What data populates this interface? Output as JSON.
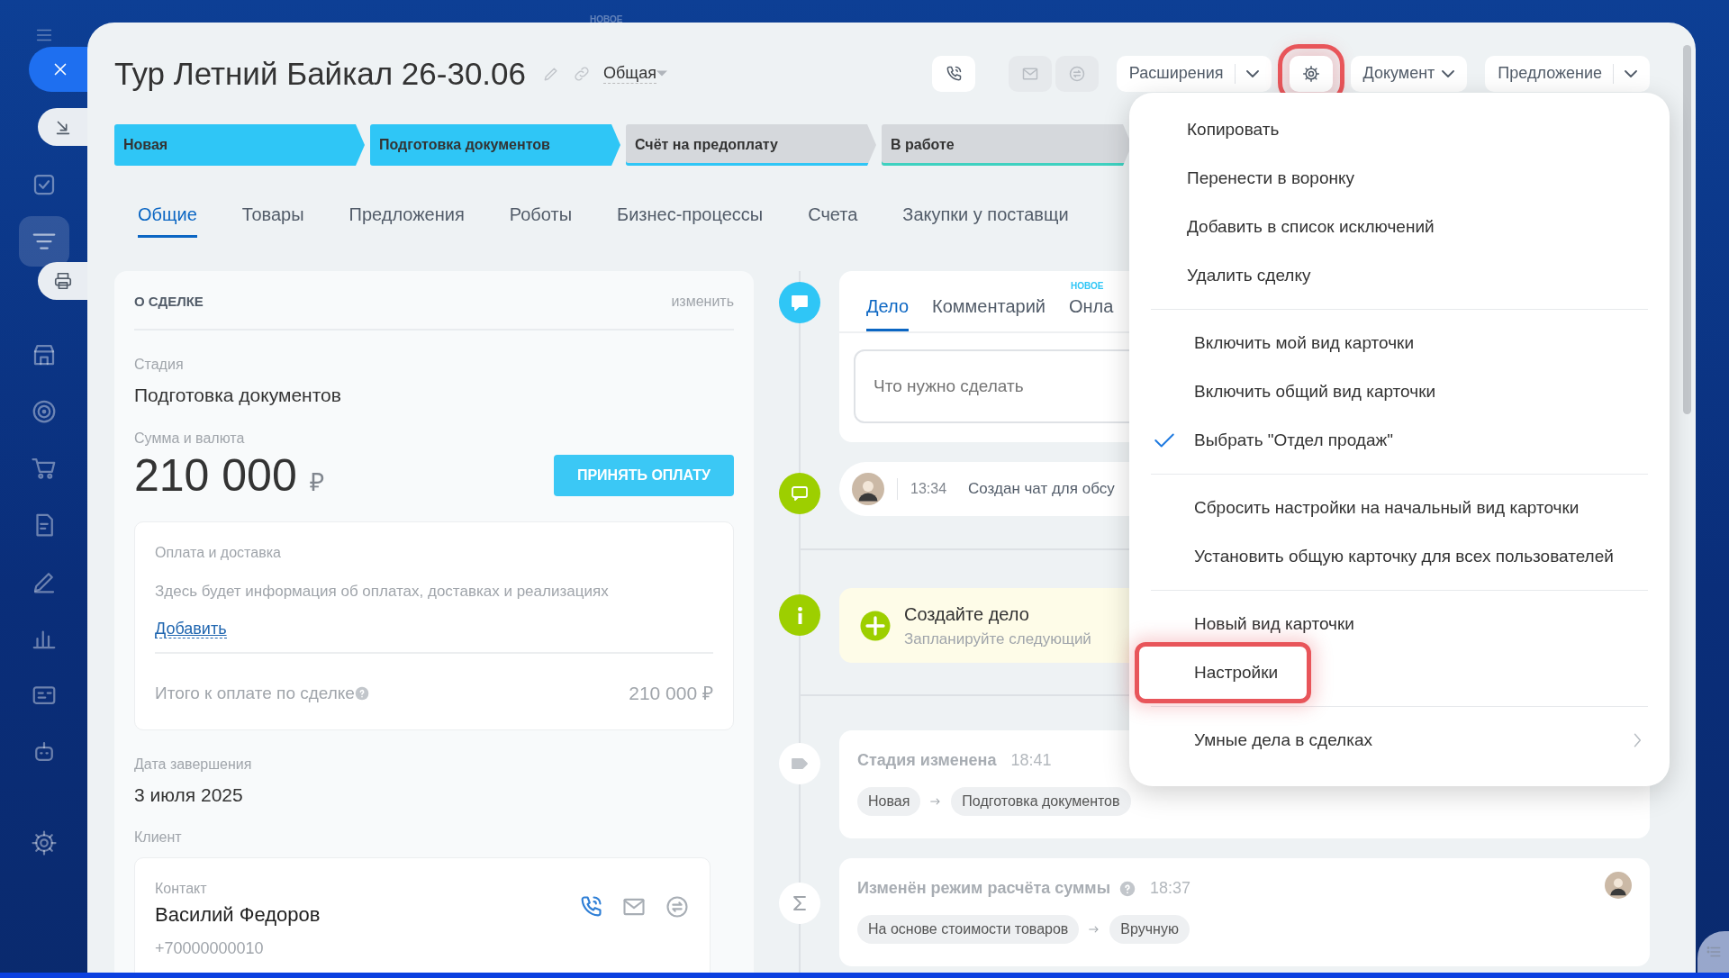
{
  "background_label": "НОВОЕ",
  "sidebar": {
    "items": [
      {
        "selected": false
      },
      {
        "selected": true
      },
      {
        "selected": false
      },
      {
        "selected": false
      },
      {
        "selected": false
      },
      {
        "selected": false
      },
      {
        "selected": false
      },
      {
        "selected": false
      },
      {
        "selected": false
      },
      {
        "selected": false
      },
      {
        "selected": false
      }
    ]
  },
  "deal": {
    "title": "Тур Летний Байкал 26-30.06",
    "category": "Общая"
  },
  "toolbar": {
    "contact_buttons": [
      {
        "disabled": false
      },
      {
        "disabled": true
      },
      {
        "disabled": true
      }
    ],
    "buttons": [
      {
        "kind": "split",
        "label": "Расширения",
        "highlighted": false
      },
      {
        "kind": "settings",
        "highlighted": true
      },
      {
        "kind": "dropdown",
        "label": "Документ",
        "highlighted": false
      },
      {
        "kind": "split",
        "label": "Предложение",
        "highlighted": false
      }
    ]
  },
  "stages": [
    {
      "label": "Новая",
      "passed": true,
      "color": "#2fc6f6"
    },
    {
      "label": "Подготовка документов",
      "passed": true,
      "color": "#2fc6f6"
    },
    {
      "label": "Счёт на предоплату",
      "passed": false,
      "color": "#2fc6f6"
    },
    {
      "label": "В работе",
      "passed": false,
      "color": "#3ed1c0"
    }
  ],
  "tabs": [
    {
      "label": "Общие",
      "selected": true
    },
    {
      "label": "Товары",
      "selected": false
    },
    {
      "label": "Предложения",
      "selected": false
    },
    {
      "label": "Роботы",
      "selected": false
    },
    {
      "label": "Бизнес-процессы",
      "selected": false
    },
    {
      "label": "Счета",
      "selected": false
    },
    {
      "label": "Закупки у поставщи",
      "selected": false
    }
  ],
  "about": {
    "title": "О СДЕЛКЕ",
    "edit_link": "изменить",
    "stage_label": "Стадия",
    "stage_value": "Подготовка документов",
    "amount_label": "Сумма и валюта",
    "amount": "210 000",
    "currency": "₽",
    "pay_button": "ПРИНЯТЬ ОПЛАТУ",
    "payments": {
      "title": "Оплата и доставка",
      "info": "Здесь будет информация об оплатах, доставках и реализациях",
      "add_link": "Добавить",
      "total_label": "Итого к оплате по сделке",
      "total": "210 000 ₽"
    },
    "close_date_label": "Дата завершения",
    "close_date": "3 июля 2025",
    "client_label": "Клиент",
    "contact": {
      "type_label": "Контакт",
      "name": "Василий Федоров",
      "phone": "+70000000010"
    }
  },
  "timeline": {
    "editor": {
      "color": "#2fc6f6",
      "tabs": [
        {
          "label": "Дело",
          "selected": true
        },
        {
          "label": "Комментарий",
          "selected": false
        },
        {
          "label": "Онла",
          "selected": false,
          "badge": "НОВОЕ"
        }
      ],
      "placeholder": "Что нужно сделать"
    },
    "items": [
      {
        "kind": "chat",
        "color": "#9dcf00",
        "time": "13:34",
        "text": "Создан чат для обсу"
      },
      {
        "kind": "todo",
        "color": "#9dcf00",
        "title": "Создайте дело",
        "subtitle": "Запланируйте следующий"
      },
      {
        "kind": "stage",
        "color": "#ffffff",
        "title": "Стадия изменена",
        "help_icon": false,
        "time": "18:41",
        "from": "Новая",
        "to": "Подготовка документов",
        "author_avatar": false
      },
      {
        "kind": "sum",
        "color": "#ffffff",
        "title": "Изменён режим расчёта суммы",
        "help_icon": true,
        "time": "18:37",
        "from": "На основе стоимости товаров",
        "to": "Вручную",
        "author_avatar": true
      }
    ]
  },
  "menu": {
    "sections": [
      {
        "items": [
          {
            "label": "Копировать",
            "kind": "action",
            "checked": false,
            "highlighted": false
          },
          {
            "label": "Перенести в воронку",
            "kind": "action",
            "checked": false,
            "highlighted": false
          },
          {
            "label": "Добавить в список исключений",
            "kind": "action",
            "checked": false,
            "highlighted": false
          },
          {
            "label": "Удалить сделку",
            "kind": "action",
            "checked": false,
            "highlighted": false
          }
        ]
      },
      {
        "items": [
          {
            "label": "Включить мой вид карточки",
            "kind": "action",
            "checked": false,
            "highlighted": false
          },
          {
            "label": "Включить общий вид карточки",
            "kind": "action",
            "checked": false,
            "highlighted": false
          },
          {
            "label": "Выбрать \"Отдел продаж\"",
            "kind": "action",
            "checked": true,
            "highlighted": false
          }
        ]
      },
      {
        "items": [
          {
            "label": "Сбросить настройки на начальный вид карточки",
            "kind": "action",
            "checked": false,
            "highlighted": false
          },
          {
            "label": "Установить общую карточку для всех пользователей",
            "kind": "action",
            "checked": false,
            "highlighted": false
          }
        ]
      },
      {
        "items": [
          {
            "label": "Новый вид карточки",
            "kind": "action",
            "checked": false,
            "highlighted": false
          },
          {
            "label": "Настройки",
            "kind": "action",
            "checked": false,
            "highlighted": true
          }
        ]
      },
      {
        "items": [
          {
            "label": "Умные дела в сделках",
            "kind": "submenu",
            "checked": false,
            "highlighted": false
          }
        ]
      }
    ]
  }
}
